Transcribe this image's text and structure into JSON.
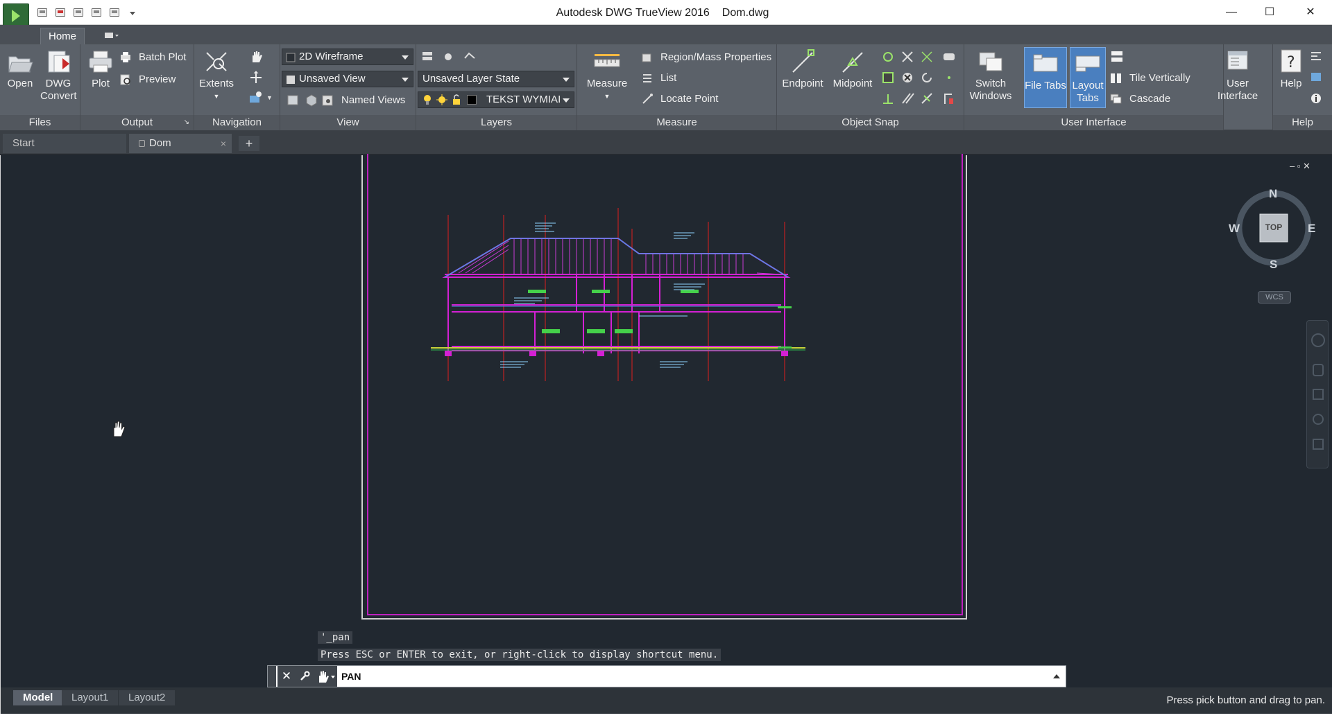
{
  "window": {
    "app_title": "Autodesk DWG TrueView 2016",
    "file_title": "Dom.dwg",
    "minimize": "—",
    "maximize": "☐",
    "close": "✕"
  },
  "ribbon": {
    "active_tab": "Home",
    "panels": {
      "files": {
        "label": "Files",
        "open": "Open",
        "dwg_convert_1": "DWG",
        "dwg_convert_2": "Convert"
      },
      "output": {
        "label": "Output",
        "plot": "Plot",
        "batch_plot": "Batch Plot",
        "preview": "Preview"
      },
      "navigation": {
        "label": "Navigation",
        "extents": "Extents"
      },
      "view": {
        "label": "View",
        "visual_style": "2D Wireframe",
        "named_view": "Unsaved View",
        "named_views": "Named Views"
      },
      "layers": {
        "label": "Layers",
        "layer_state": "Unsaved Layer State",
        "current_layer": "TEKST WYMIAI"
      },
      "measure": {
        "label": "Measure",
        "measure": "Measure",
        "region_mass": "Region/Mass Properties",
        "list": "List",
        "locate_point": "Locate Point"
      },
      "object_snap": {
        "label": "Object Snap",
        "endpoint": "Endpoint",
        "midpoint": "Midpoint"
      },
      "user_interface": {
        "label": "User Interface",
        "switch_windows_1": "Switch",
        "switch_windows_2": "Windows",
        "file_tabs_1": "File Tabs",
        "layout_tabs_1": "Layout",
        "layout_tabs_2": "Tabs",
        "tile_vertically": "Tile Vertically",
        "cascade": "Cascade",
        "user_interface_1": "User",
        "user_interface_2": "Interface"
      },
      "help": {
        "label": "Help",
        "help": "Help"
      }
    }
  },
  "file_tabs": {
    "start": "Start",
    "dom": "Dom",
    "dom_close": "×",
    "new_tab": "+"
  },
  "viewcube": {
    "n": "N",
    "s": "S",
    "e": "E",
    "w": "W",
    "face": "TOP",
    "wcs": "WCS"
  },
  "viewport_controls": "‒ ▫ ✕",
  "command": {
    "history_1": "'_pan",
    "history_2": "Press ESC or ENTER to exit, or right-click to display shortcut menu.",
    "current": "PAN"
  },
  "layout_tabs": [
    "Model",
    "Layout1",
    "Layout2"
  ],
  "status_message": "Press pick button and drag to pan.",
  "colors": {
    "ribbon_bg": "#5b6169",
    "canvas_bg": "#212830",
    "sheet_border": "#c020c0",
    "active_toggle": "#4a7fbf"
  }
}
